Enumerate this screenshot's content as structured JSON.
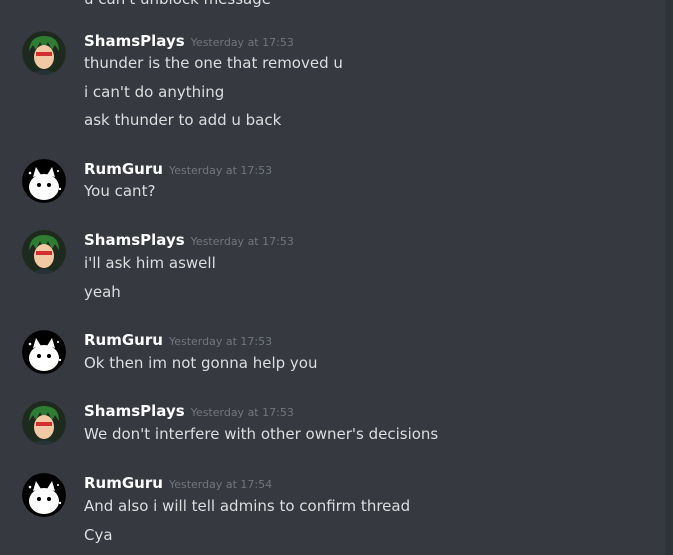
{
  "cutoff_line": "u can't unblock message",
  "messages": [
    {
      "author": "ShamsPlays",
      "avatar": "green-hair-anime-avatar-icon",
      "timestamp": "Yesterday at 17:53",
      "lines": [
        "thunder is the one that removed u",
        "i can't do anything",
        "ask thunder to add u back"
      ]
    },
    {
      "author": "RumGuru",
      "avatar": "white-cat-mask-avatar-icon",
      "timestamp": "Yesterday at 17:53",
      "lines": [
        "You cant?"
      ]
    },
    {
      "author": "ShamsPlays",
      "avatar": "green-hair-anime-avatar-icon",
      "timestamp": "Yesterday at 17:53",
      "lines": [
        "i'll ask him aswell",
        "yeah"
      ]
    },
    {
      "author": "RumGuru",
      "avatar": "white-cat-mask-avatar-icon",
      "timestamp": "Yesterday at 17:53",
      "lines": [
        "Ok then im not gonna help you"
      ]
    },
    {
      "author": "ShamsPlays",
      "avatar": "green-hair-anime-avatar-icon",
      "timestamp": "Yesterday at 17:53",
      "lines": [
        "We don't interfere with other owner's decisions"
      ]
    },
    {
      "author": "RumGuru",
      "avatar": "white-cat-mask-avatar-icon",
      "timestamp": "Yesterday at 17:54",
      "lines": [
        "And also i will tell admins to confirm thread",
        "Cya"
      ]
    }
  ],
  "colors": {
    "background": "#36393f",
    "username": "#ffffff",
    "message_text": "#dcddde",
    "timestamp": "#72767d"
  }
}
